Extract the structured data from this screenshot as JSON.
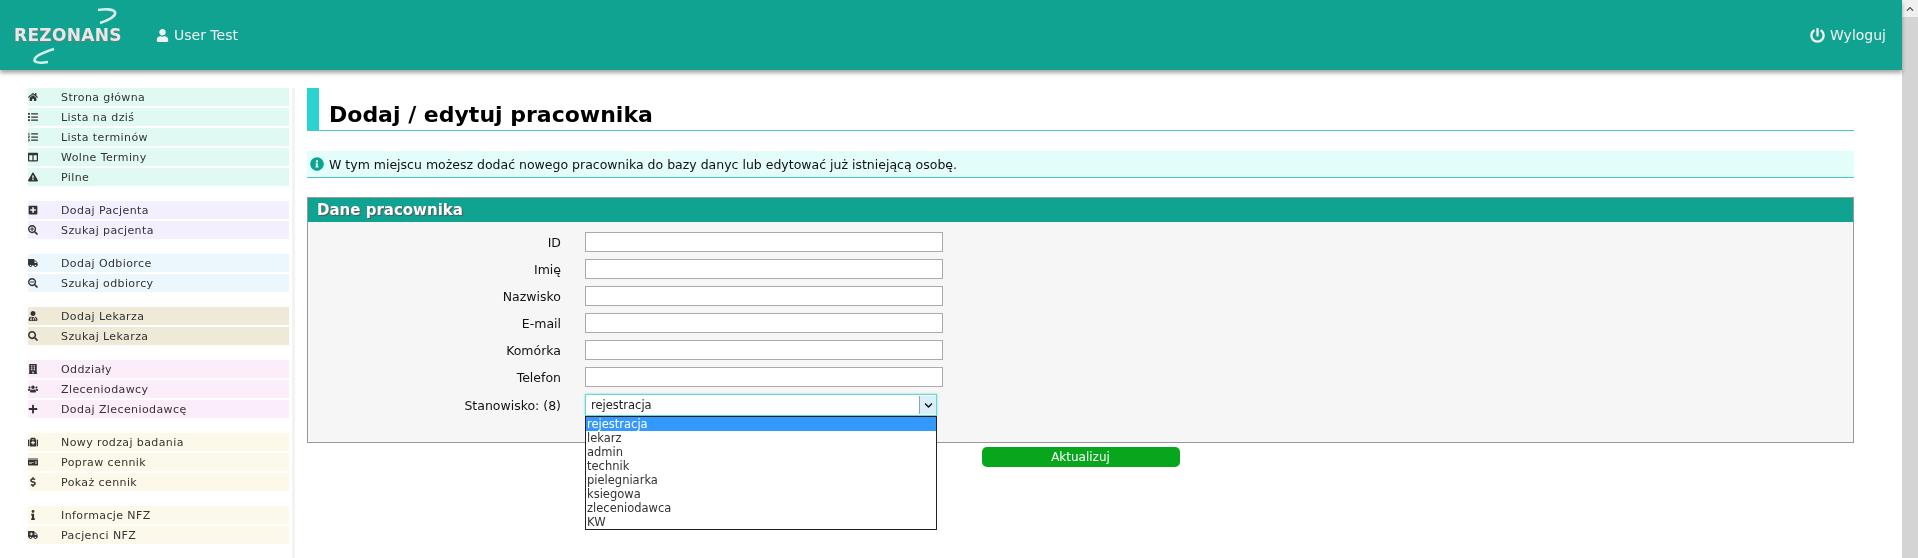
{
  "header": {
    "logo": "REZONANS",
    "user": "User Test",
    "logout": "Wyloguj"
  },
  "sidebar": {
    "groups": [
      {
        "color": "#e0faf3",
        "items": [
          "Strona główna",
          "Lista na dziś",
          "Lista terminów",
          "Wolne Terminy",
          "Pilne"
        ]
      },
      {
        "color": "#f3efff",
        "items": [
          "Dodaj Pacjenta",
          "Szukaj pacjenta"
        ]
      },
      {
        "color": "#ecf6fd",
        "items": [
          "Dodaj Odbiorce",
          "Szukaj odbiorcy"
        ]
      },
      {
        "color": "#efe9d8",
        "items": [
          "Dodaj Lekarza",
          "Szukaj Lekarza"
        ]
      },
      {
        "color": "#fcedfa",
        "items": [
          "Oddziały",
          "Zleceniodawcy",
          "Dodaj Zleceniodawcę"
        ]
      },
      {
        "color": "#fdf9ea",
        "items": [
          "Nowy rodzaj badania",
          "Popraw cennik",
          "Pokaż cennik"
        ]
      },
      {
        "color": "#fdf9ea",
        "items": [
          "Informacje NFZ",
          "Pacjenci NFZ"
        ]
      }
    ]
  },
  "page": {
    "title": "Dodaj / edytuj pracownika",
    "info": "W tym miejscu możesz dodać nowego pracownika do bazy danyc lub edytować już istniejącą osobę."
  },
  "panel": {
    "title": "Dane pracownika",
    "fields": [
      {
        "label": "ID"
      },
      {
        "label": "Imię"
      },
      {
        "label": "Nazwisko"
      },
      {
        "label": "E-mail"
      },
      {
        "label": "Komórka"
      },
      {
        "label": "Telefon"
      }
    ],
    "select": {
      "label": "Stanowisko: (8)",
      "value": "rejestracja",
      "expanded": true,
      "options": [
        {
          "label": "rejestracja",
          "selected": true
        },
        {
          "label": "lekarz",
          "selected": false
        },
        {
          "label": "admin",
          "selected": false
        },
        {
          "label": "technik",
          "selected": false
        },
        {
          "label": "pielegniarka",
          "selected": false
        },
        {
          "label": "ksiegowa",
          "selected": false
        },
        {
          "label": "zleceniodawca",
          "selected": false
        },
        {
          "label": "KW",
          "selected": false
        }
      ]
    }
  },
  "submit": "Aktualizuj"
}
